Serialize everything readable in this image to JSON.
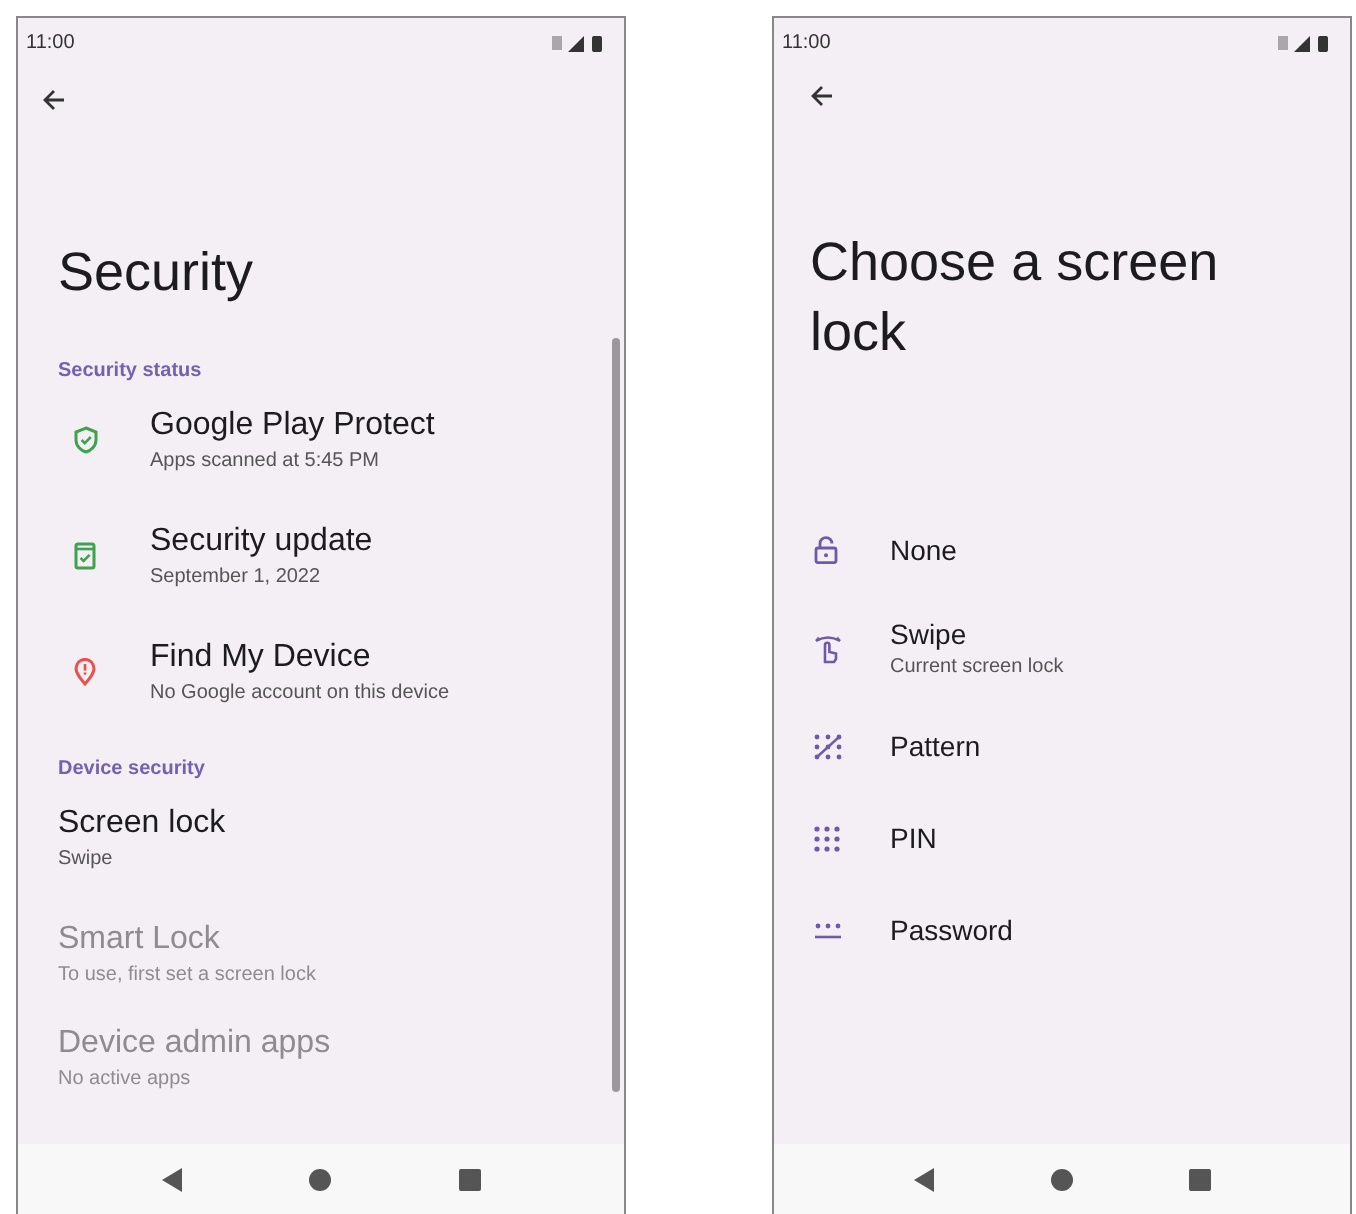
{
  "screens": [
    {
      "kind": "settings",
      "status_bar": {
        "time": "11:00"
      },
      "title": "Security",
      "sections": [
        {
          "header": "Security status",
          "items": [
            {
              "title": "Google Play Protect",
              "subtitle": "Apps scanned at 5:45 PM",
              "color": "#3fa34d",
              "disabled": false
            },
            {
              "title": "Security update",
              "subtitle": "September 1, 2022",
              "color": "#3fa34d",
              "disabled": false
            },
            {
              "title": "Find My Device",
              "subtitle": "No Google account on this device",
              "color": "#e5534b",
              "disabled": false
            }
          ]
        },
        {
          "header": "Device security",
          "items": [
            {
              "title": "Screen lock",
              "subtitle": "Swipe",
              "disabled": false
            },
            {
              "title": "Smart Lock",
              "subtitle": "To use, first set a screen lock",
              "disabled": true
            },
            {
              "title": "Device admin apps",
              "subtitle": "No active apps",
              "disabled": true
            }
          ]
        }
      ]
    },
    {
      "kind": "picker",
      "status_bar": {
        "time": "11:00"
      },
      "title": "Choose a screen lock",
      "options": [
        {
          "title": "None"
        },
        {
          "title": "Swipe",
          "subtitle": "Current screen lock"
        },
        {
          "title": "Pattern"
        },
        {
          "title": "PIN"
        },
        {
          "title": "Password"
        }
      ]
    }
  ]
}
